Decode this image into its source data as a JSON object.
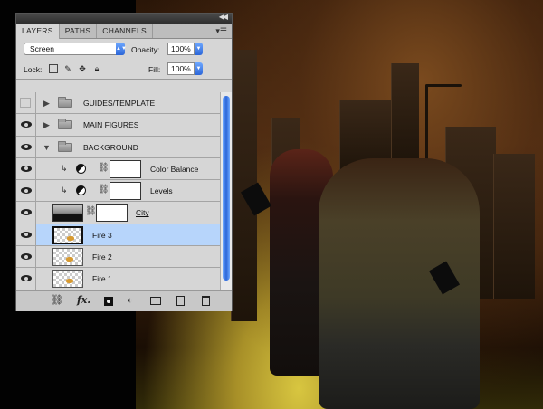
{
  "panel": {
    "tabs": [
      "LAYERS",
      "PATHS",
      "CHANNELS"
    ],
    "blend_mode": "Screen",
    "opacity_label": "Opacity:",
    "opacity_value": "100%",
    "lock_label": "Lock:",
    "fill_label": "Fill:",
    "fill_value": "100%"
  },
  "layers": [
    {
      "name": "GUIDES/TEMPLATE",
      "type": "group",
      "visible": false,
      "expanded": false
    },
    {
      "name": "MAIN FIGURES",
      "type": "group",
      "visible": true,
      "expanded": false
    },
    {
      "name": "BACKGROUND",
      "type": "group",
      "visible": true,
      "expanded": true
    },
    {
      "name": "Color Balance",
      "type": "adjustment",
      "visible": true
    },
    {
      "name": "Levels",
      "type": "adjustment",
      "visible": true
    },
    {
      "name": "City",
      "type": "masked-image",
      "visible": true
    },
    {
      "name": "Fire 3",
      "type": "image",
      "visible": true,
      "selected": true
    },
    {
      "name": "Fire 2",
      "type": "image",
      "visible": true
    },
    {
      "name": "Fire 1",
      "type": "image",
      "visible": true
    }
  ],
  "colors": {
    "selection": "#b7d5fb",
    "accent_blue": "#2c66d8"
  }
}
